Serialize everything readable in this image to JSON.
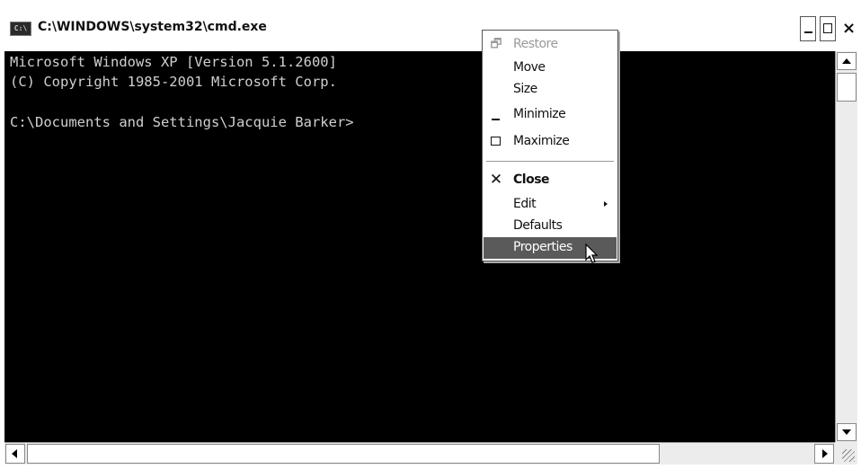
{
  "window": {
    "title": "C:\\WINDOWS\\system32\\cmd.exe",
    "icon_text": "C:\\"
  },
  "console": {
    "lines": [
      "Microsoft Windows XP [Version 5.1.2600]",
      "(C) Copyright 1985-2001 Microsoft Corp.",
      "",
      "C:\\Documents and Settings\\Jacquie Barker>"
    ]
  },
  "system_menu": {
    "items": [
      {
        "label": "Restore",
        "icon": "restore-icon",
        "disabled": true
      },
      {
        "label": "Move"
      },
      {
        "label": "Size"
      },
      {
        "label": "Minimize",
        "icon": "minimize-icon"
      },
      {
        "label": "Maximize",
        "icon": "maximize-icon"
      },
      {
        "label": "Close",
        "icon": "close-icon",
        "bold": true
      },
      {
        "label": "Edit",
        "has_submenu": true
      },
      {
        "label": "Defaults"
      },
      {
        "label": "Properties",
        "selected": true
      }
    ]
  },
  "colors": {
    "console_bg": "#000000",
    "console_fg": "#d0d0d0",
    "menu_highlight": "#5a5a5a"
  }
}
